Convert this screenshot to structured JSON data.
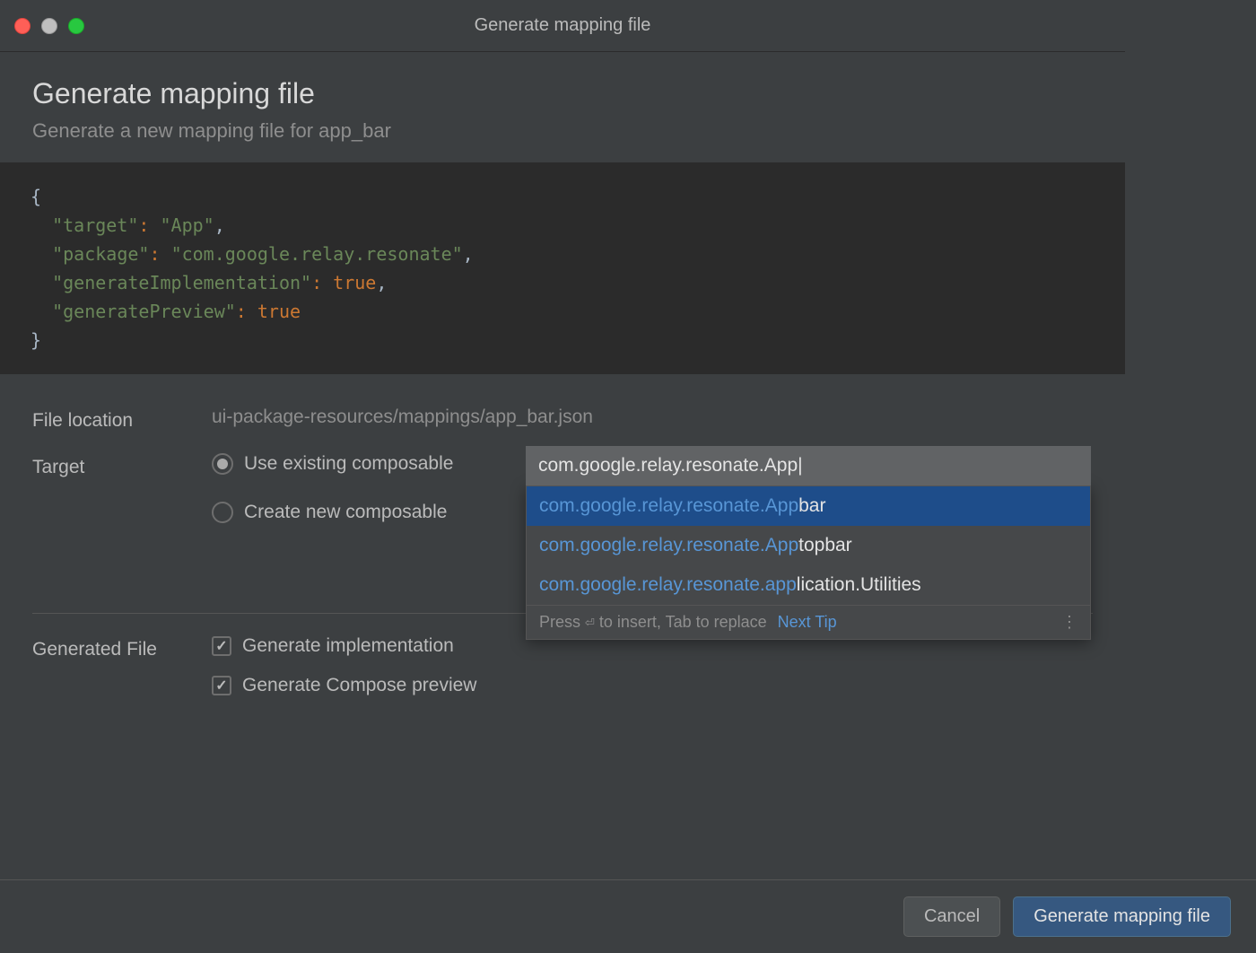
{
  "titlebar": {
    "title": "Generate mapping file"
  },
  "header": {
    "title": "Generate mapping file",
    "subtitle": "Generate a new mapping file for app_bar"
  },
  "code": {
    "lines": [
      {
        "raw": "{"
      },
      {
        "indent": 1,
        "key": "\"target\"",
        "sep": ": ",
        "val": "\"App\"",
        "trail": ","
      },
      {
        "indent": 1,
        "key": "\"package\"",
        "sep": ": ",
        "val": "\"com.google.relay.resonate\"",
        "trail": ","
      },
      {
        "indent": 1,
        "key": "\"generateImplementation\"",
        "sep": ": ",
        "kw": "true",
        "trail": ","
      },
      {
        "indent": 1,
        "key": "\"generatePreview\"",
        "sep": ": ",
        "kw": "true"
      },
      {
        "raw": "}"
      }
    ]
  },
  "form": {
    "file_location": {
      "label": "File location",
      "value": "ui-package-resources/mappings/app_bar.json"
    },
    "target": {
      "label": "Target",
      "option_existing": "Use existing composable",
      "option_create": "Create new composable",
      "selected": "existing",
      "input_value": "com.google.relay.resonate.App|"
    },
    "generated_file": {
      "label": "Generated File",
      "gen_impl": "Generate implementation",
      "gen_preview": "Generate Compose preview"
    }
  },
  "autocomplete": {
    "items": [
      {
        "match": "com.google.relay.resonate.App",
        "rest": "bar",
        "selected": true
      },
      {
        "match": "com.google.relay.resonate.App",
        "rest": "topbar",
        "selected": false
      },
      {
        "match": "com.google.relay.resonate.app",
        "rest": "lication.Utilities",
        "selected": false
      }
    ],
    "footer_hint_pre": "Press ",
    "footer_hint_enter": "⏎",
    "footer_hint_post": " to insert, Tab to replace",
    "footer_link": "Next Tip"
  },
  "buttons": {
    "cancel": "Cancel",
    "generate": "Generate mapping file"
  }
}
